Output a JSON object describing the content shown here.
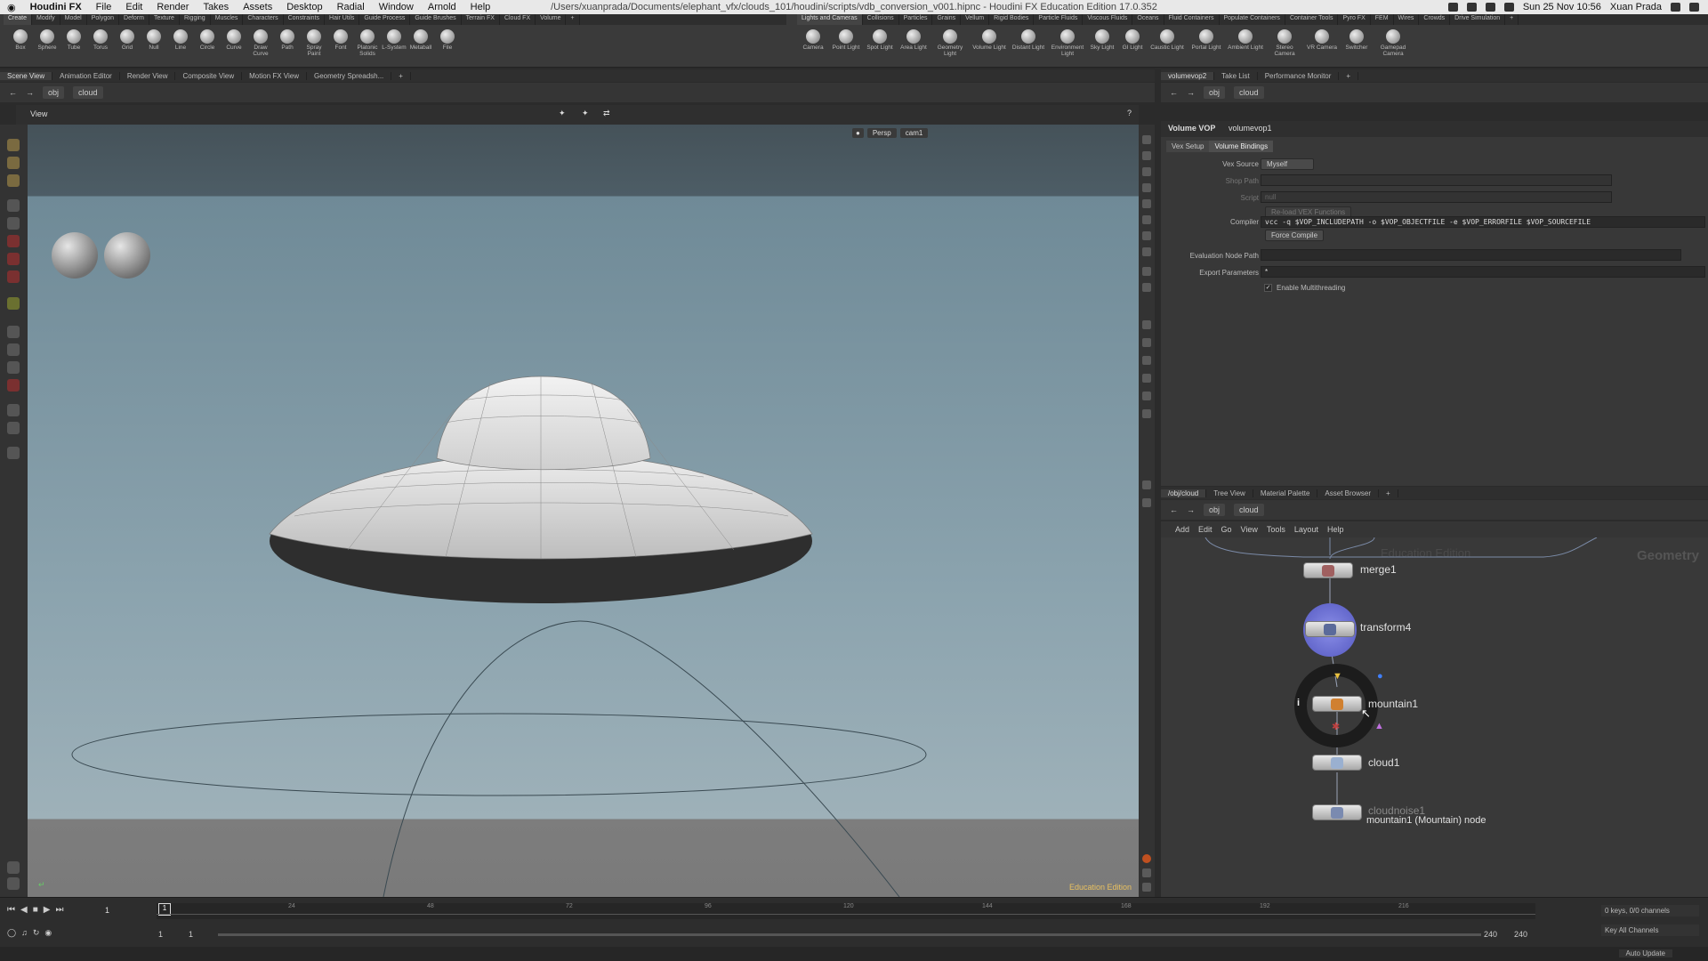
{
  "macbar": {
    "apple": "",
    "app_name": "Houdini FX",
    "menus": [
      "File",
      "Edit",
      "Render",
      "Takes",
      "Assets",
      "Desktop",
      "Radial",
      "Window",
      "Arnold",
      "Help"
    ],
    "window_title": "/Users/xuanprada/Documents/elephant_vfx/clouds_101/houdini/scripts/vdb_conversion_v001.hipnc - Houdini FX Education Edition 17.0.352",
    "datetime": "Sun 25 Nov 10:56",
    "user": "Xuan Prada"
  },
  "shelf_left": {
    "tabs": [
      "Create",
      "Modify",
      "Model",
      "Polygon",
      "Deform",
      "Texture",
      "Rigging",
      "Muscles",
      "Characters",
      "Constraints",
      "Hair Utils",
      "Guide Process",
      "Guide Brushes",
      "Terrain FX",
      "Cloud FX",
      "Volume"
    ],
    "tools": [
      "Box",
      "Sphere",
      "Tube",
      "Torus",
      "Grid",
      "Null",
      "Line",
      "Circle",
      "Curve",
      "Draw Curve",
      "Path",
      "Spray Paint",
      "Font",
      "Platonic Solids",
      "L-System",
      "Metaball",
      "File"
    ]
  },
  "shelf_right": {
    "tabs": [
      "Lights and Cameras",
      "Collisions",
      "Particles",
      "Grains",
      "Vellum",
      "Rigid Bodies",
      "Particle Fluids",
      "Viscous Fluids",
      "Oceans",
      "Fluid Containers",
      "Populate Containers",
      "Container Tools",
      "Pyro FX",
      "FEM",
      "Wires",
      "Crowds",
      "Drive Simulation"
    ],
    "tools": [
      "Camera",
      "Point Light",
      "Spot Light",
      "Area Light",
      "Geometry Light",
      "Volume Light",
      "Distant Light",
      "Environment Light",
      "Sky Light",
      "GI Light",
      "Caustic Light",
      "Portal Light",
      "Ambient Light",
      "Stereo Camera",
      "VR Camera",
      "Switcher",
      "Gamepad Camera"
    ]
  },
  "viewer": {
    "pane_tabs": [
      "Scene View",
      "Animation Editor",
      "Render View",
      "Composite View",
      "Motion FX View",
      "Geometry Spreadsh..."
    ],
    "path_obj": "obj",
    "path_node": "cloud",
    "view_label": "View",
    "persp": "Persp",
    "cam": "cam1",
    "edition": "Education Edition"
  },
  "params": {
    "pane_tabs": [
      "volumevop2",
      "Take List",
      "Performance Monitor"
    ],
    "path_obj": "obj",
    "path_node": "cloud",
    "node_type": "Volume VOP",
    "node_name": "volumevop1",
    "tabs": [
      "Vex Setup",
      "Volume Bindings"
    ],
    "vex_source_label": "Vex Source",
    "vex_source_value": "Myself",
    "shop_path_label": "Shop Path",
    "script_label": "Script",
    "script_value": "null",
    "reload_label": "Re-load VEX Functions",
    "compiler_label": "Compiler",
    "compiler_value": "vcc -q $VOP_INCLUDEPATH -o $VOP_OBJECTFILE -e $VOP_ERRORFILE $VOP_SOURCEFILE",
    "force_compile": "Force Compile",
    "eval_node_label": "Evaluation Node Path",
    "export_params_label": "Export Parameters",
    "export_params_value": "*",
    "multithread_label": "Enable Multithreading"
  },
  "network": {
    "pane_tabs": [
      "/obj/cloud",
      "Tree View",
      "Material Palette",
      "Asset Browser"
    ],
    "path_obj": "obj",
    "path_node": "cloud",
    "menus": [
      "Add",
      "Edit",
      "Go",
      "View",
      "Tools",
      "Layout",
      "Help"
    ],
    "watermark": "Education Edition",
    "context": "Geometry",
    "nodes": [
      "merge1",
      "transform4",
      "mountain1",
      "cloud1",
      "cloudnoise1"
    ],
    "tooltip": "mountain1 (Mountain) node"
  },
  "timeline": {
    "frame": "1",
    "start": "1",
    "start2": "1",
    "end": "240",
    "end2": "240",
    "ticks": [
      "24",
      "48",
      "72",
      "96",
      "120",
      "144",
      "168",
      "192",
      "216"
    ],
    "keys_label": "0 keys, 0/0 channels",
    "key_channels": "Key All Channels",
    "auto_update": "Auto Update"
  },
  "colors": {
    "accent": "#5c8fd6",
    "shelf_bg": "#3a3a3a",
    "viewport_sky": "#8ba3ae",
    "node_selected": "#6a6ed0"
  }
}
